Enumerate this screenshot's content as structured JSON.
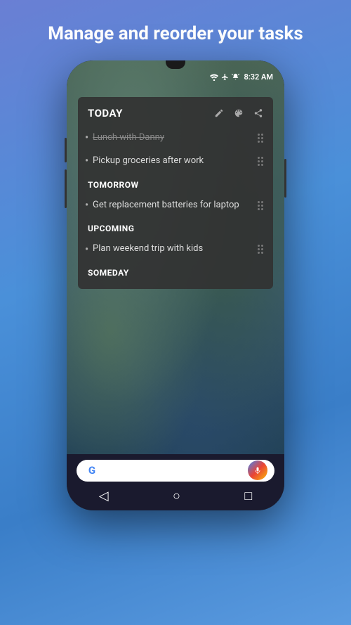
{
  "header": {
    "title": "Manage and reorder your tasks"
  },
  "statusBar": {
    "time": "8:32 AM",
    "icons": [
      "wifi",
      "airplane",
      "alarm"
    ]
  },
  "card": {
    "title": "TODAY",
    "actions": [
      "edit",
      "palette",
      "share"
    ],
    "sections": [
      {
        "label": "TODAY",
        "tasks": [
          {
            "text": "Lunch with Danny",
            "completed": true
          },
          {
            "text": "Pickup groceries after work",
            "completed": false
          }
        ]
      },
      {
        "label": "TOMORROW",
        "tasks": [
          {
            "text": "Get replacement batteries for laptop",
            "completed": false
          }
        ]
      },
      {
        "label": "UPCOMING",
        "tasks": [
          {
            "text": "Plan weekend trip with kids",
            "completed": false
          }
        ]
      },
      {
        "label": "SOMEDAY",
        "tasks": []
      }
    ]
  },
  "searchBar": {
    "placeholder": "",
    "googleLogo": "G"
  },
  "navButtons": {
    "back": "◁",
    "home": "○",
    "recent": "□"
  }
}
